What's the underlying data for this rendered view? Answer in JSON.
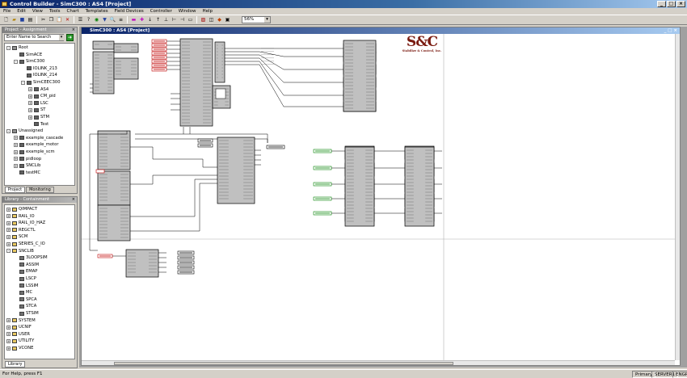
{
  "window": {
    "title": "Control Builder - SimC300 : AS4 [Project]"
  },
  "menu": [
    "File",
    "Edit",
    "View",
    "Tools",
    "Chart",
    "Templates",
    "Field Devices",
    "Controller",
    "Window",
    "Help"
  ],
  "toolbar": {
    "zoom": "56%"
  },
  "project_panel": {
    "title": "Project - Assignment",
    "search_placeholder": "Enter Name to Search",
    "tree": [
      {
        "label": "Root",
        "depth": 0,
        "exp": "-"
      },
      {
        "label": "SimACE",
        "depth": 1,
        "exp": ""
      },
      {
        "label": "SimC300",
        "depth": 1,
        "exp": "-"
      },
      {
        "label": "IOLINK_213",
        "depth": 2,
        "exp": ""
      },
      {
        "label": "IOLINK_214",
        "depth": 2,
        "exp": ""
      },
      {
        "label": "SimCEEC300",
        "depth": 2,
        "exp": "-"
      },
      {
        "label": "AS4",
        "depth": 3,
        "exp": "+"
      },
      {
        "label": "CM_pid",
        "depth": 3,
        "exp": "+"
      },
      {
        "label": "LSC",
        "depth": 3,
        "exp": "+"
      },
      {
        "label": "ST",
        "depth": 3,
        "exp": "+"
      },
      {
        "label": "STM",
        "depth": 3,
        "exp": "+"
      },
      {
        "label": "Test",
        "depth": 3,
        "exp": ""
      },
      {
        "label": "Unassigned",
        "depth": 0,
        "exp": "-"
      },
      {
        "label": "example_cascade",
        "depth": 1,
        "exp": "+"
      },
      {
        "label": "example_motor",
        "depth": 1,
        "exp": "+"
      },
      {
        "label": "example_scm",
        "depth": 1,
        "exp": "+"
      },
      {
        "label": "pidloop",
        "depth": 1,
        "exp": "+"
      },
      {
        "label": "SNCLib",
        "depth": 1,
        "exp": "+"
      },
      {
        "label": "testMC",
        "depth": 1,
        "exp": ""
      }
    ],
    "tabs": [
      "Project",
      "Monitoring"
    ]
  },
  "library_panel": {
    "title": "Library - Containment",
    "tree": [
      {
        "label": "QIMPACT",
        "depth": 0,
        "exp": "+"
      },
      {
        "label": "RAIL_IO",
        "depth": 0,
        "exp": "+"
      },
      {
        "label": "RAIL_IO_HAZ",
        "depth": 0,
        "exp": "+"
      },
      {
        "label": "REGCTL",
        "depth": 0,
        "exp": "+"
      },
      {
        "label": "SCM",
        "depth": 0,
        "exp": "+"
      },
      {
        "label": "SERIES_C_IO",
        "depth": 0,
        "exp": "+"
      },
      {
        "label": "SNCLIB",
        "depth": 0,
        "exp": "-"
      },
      {
        "label": "3LOOPSIM",
        "depth": 1,
        "exp": ""
      },
      {
        "label": "ASSIM",
        "depth": 1,
        "exp": ""
      },
      {
        "label": "EMAP",
        "depth": 1,
        "exp": ""
      },
      {
        "label": "LSCP",
        "depth": 1,
        "exp": ""
      },
      {
        "label": "LSSIM",
        "depth": 1,
        "exp": ""
      },
      {
        "label": "MC",
        "depth": 1,
        "exp": ""
      },
      {
        "label": "SPCA",
        "depth": 1,
        "exp": ""
      },
      {
        "label": "STCA",
        "depth": 1,
        "exp": ""
      },
      {
        "label": "STSIM",
        "depth": 1,
        "exp": ""
      },
      {
        "label": "SYSTEM",
        "depth": 0,
        "exp": "+"
      },
      {
        "label": "UCNIF",
        "depth": 0,
        "exp": "+"
      },
      {
        "label": "USER",
        "depth": 0,
        "exp": "+"
      },
      {
        "label": "UTILITY",
        "depth": 0,
        "exp": "+"
      },
      {
        "label": "VCONE",
        "depth": 0,
        "exp": "+"
      }
    ],
    "tab": "Library"
  },
  "document": {
    "title": "SimC300 : AS4 [Project]",
    "logo": "S&C",
    "logo_sub": "Stabilize & Control, Inc."
  },
  "status": {
    "help": "For Help, press F1",
    "mode": "Primary",
    "server": "SERVER1",
    "user": "ENGR"
  },
  "colors": {
    "title_bar": "#0a246a",
    "block_fill": "#c0c0c0",
    "input_tag": "#c00000",
    "green_tag": "#008000",
    "logo": "#7a1a10"
  }
}
